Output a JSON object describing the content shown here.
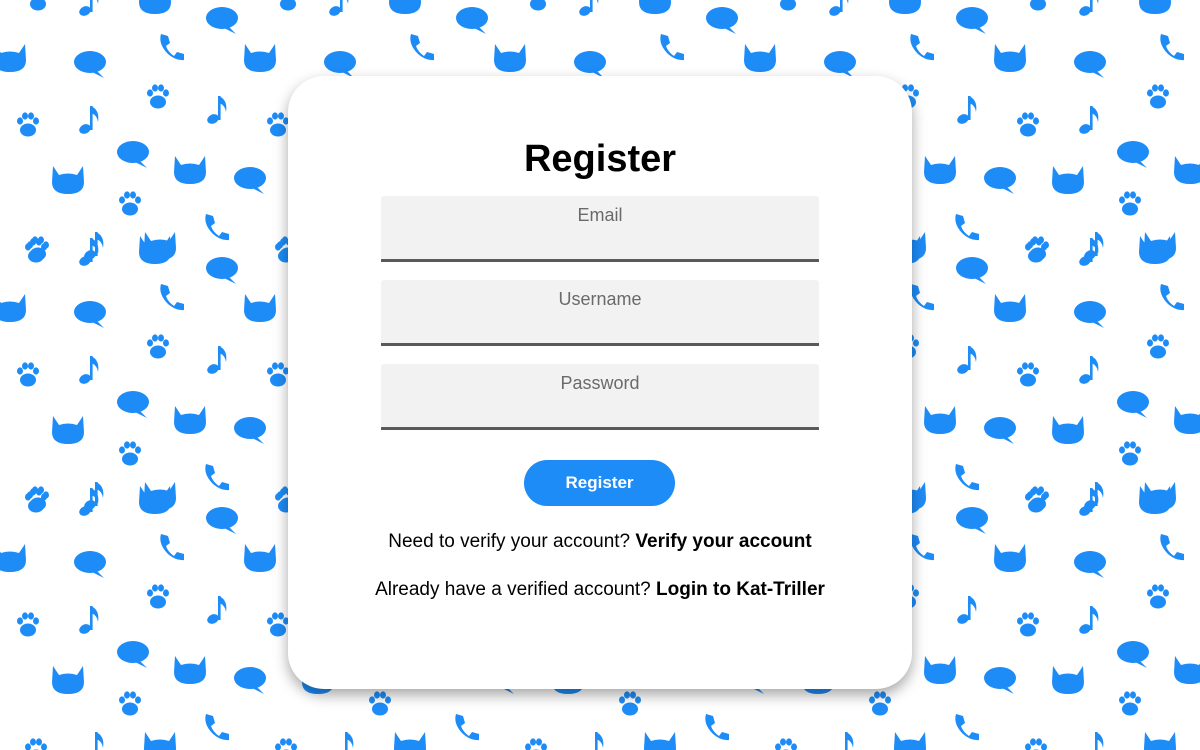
{
  "page": {
    "background_color": "#ffffff",
    "pattern_color": "#1e8cf7",
    "pattern_icons": [
      "paw-icon",
      "music-note-icon",
      "cat-head-icon",
      "speech-bubble-icon",
      "phone-icon"
    ]
  },
  "form": {
    "title": "Register",
    "email_placeholder": "Email",
    "username_placeholder": "Username",
    "password_placeholder": "Password",
    "submit_label": "Register",
    "submit_color": "#1e8cf7"
  },
  "links": {
    "verify_prompt": "Need to verify your account?",
    "verify_link": "Verify your account",
    "login_prompt": "Already have a verified account?",
    "login_link": "Login to Kat-Triller"
  }
}
